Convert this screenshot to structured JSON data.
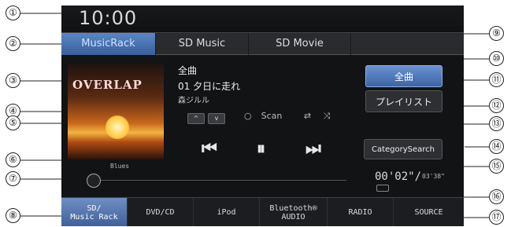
{
  "screen": {
    "clock": "10:00",
    "source_tabs": [
      "MusicRack",
      "SD Music",
      "SD Movie"
    ],
    "album_art": {
      "title_text": "OVERLAP",
      "genre": "Blues"
    },
    "track": {
      "list_mode": "全曲",
      "title": "01 夕日に走れ",
      "artist": "森ジルル"
    },
    "up_label": "^",
    "down_label": "v",
    "modes": {
      "scan": "Scan",
      "repeat_icon": "repeat-icon",
      "shuffle_icon": "shuffle-icon"
    },
    "transport": {
      "prev": "⏮",
      "pause": "⏸",
      "next": "⏭"
    },
    "right_buttons": {
      "all_songs": "全曲",
      "playlist": "プレイリスト",
      "category_search": "CategorySearch"
    },
    "time": {
      "elapsed": "00'02\"/",
      "total": "03'38\""
    },
    "bottom_tabs": [
      "SD/\nMusic Rack",
      "DVD/CD",
      "iPod",
      "Bluetooth®\nAUDIO",
      "RADIO",
      "SOURCE"
    ]
  },
  "callouts": [
    "①",
    "②",
    "③",
    "④",
    "⑤",
    "⑥",
    "⑦",
    "⑧",
    "⑨",
    "⑩",
    "⑪",
    "⑫",
    "⑬",
    "⑭",
    "⑮",
    "⑯",
    "⑰"
  ]
}
